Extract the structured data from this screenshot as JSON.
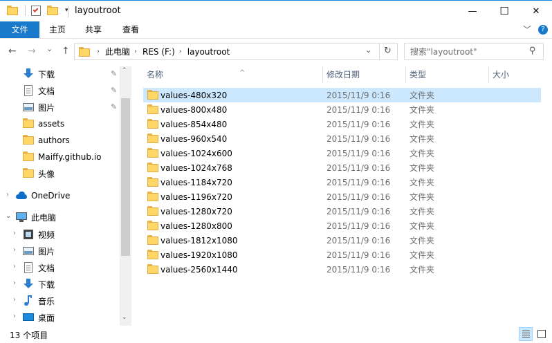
{
  "window": {
    "title": "layoutroot",
    "minimize_glyph": "—",
    "maximize_glyph": "☐",
    "close_glyph": "✕"
  },
  "ribbon": {
    "tabs": [
      "文件",
      "主页",
      "共享",
      "查看"
    ],
    "expand_glyph": "﹀",
    "help_glyph": "?"
  },
  "address": {
    "back_glyph": "←",
    "forward_glyph": "→",
    "recent_glyph": "⌄",
    "up_glyph": "↑",
    "crumbs": [
      "此电脑",
      "RES (F:)",
      "layoutroot"
    ],
    "crumb_sep": "›",
    "dropdown_glyph": "⌄",
    "refresh_glyph": "↻",
    "search_placeholder": "搜索\"layoutroot\"",
    "search_glyph": "⚲"
  },
  "nav": {
    "pin_glyph": "✎",
    "chevron_glyph": "›",
    "open_chevron_glyph": "⌄",
    "scroll_up_glyph": "⌃",
    "scroll_down_glyph": "⌄",
    "quick_access": [
      {
        "label": "下载",
        "icon": "download-icon",
        "pinned": true
      },
      {
        "label": "文档",
        "icon": "document-icon",
        "pinned": true
      },
      {
        "label": "图片",
        "icon": "pictures-icon",
        "pinned": true
      },
      {
        "label": "assets",
        "icon": "folder-icon",
        "pinned": false
      },
      {
        "label": "authors",
        "icon": "folder-icon",
        "pinned": false
      },
      {
        "label": "Maiffy.github.io",
        "icon": "folder-icon",
        "pinned": false
      },
      {
        "label": "头像",
        "icon": "folder-icon",
        "pinned": false
      }
    ],
    "onedrive": "OneDrive",
    "this_pc": "此电脑",
    "pc_items": [
      {
        "label": "视频",
        "icon": "videos-icon"
      },
      {
        "label": "图片",
        "icon": "pictures-icon"
      },
      {
        "label": "文档",
        "icon": "document-icon"
      },
      {
        "label": "下载",
        "icon": "download-icon"
      },
      {
        "label": "音乐",
        "icon": "music-icon"
      },
      {
        "label": "桌面",
        "icon": "desktop-icon"
      }
    ]
  },
  "content": {
    "columns": [
      "名称",
      "修改日期",
      "类型",
      "大小"
    ],
    "sort_glyph": "^",
    "rows": [
      {
        "name": "values-480x320",
        "date": "2015/11/9 0:16",
        "type": "文件夹",
        "selected": true
      },
      {
        "name": "values-800x480",
        "date": "2015/11/9 0:16",
        "type": "文件夹",
        "selected": false
      },
      {
        "name": "values-854x480",
        "date": "2015/11/9 0:16",
        "type": "文件夹",
        "selected": false
      },
      {
        "name": "values-960x540",
        "date": "2015/11/9 0:16",
        "type": "文件夹",
        "selected": false
      },
      {
        "name": "values-1024x600",
        "date": "2015/11/9 0:16",
        "type": "文件夹",
        "selected": false
      },
      {
        "name": "values-1024x768",
        "date": "2015/11/9 0:16",
        "type": "文件夹",
        "selected": false
      },
      {
        "name": "values-1184x720",
        "date": "2015/11/9 0:16",
        "type": "文件夹",
        "selected": false
      },
      {
        "name": "values-1196x720",
        "date": "2015/11/9 0:16",
        "type": "文件夹",
        "selected": false
      },
      {
        "name": "values-1280x720",
        "date": "2015/11/9 0:16",
        "type": "文件夹",
        "selected": false
      },
      {
        "name": "values-1280x800",
        "date": "2015/11/9 0:16",
        "type": "文件夹",
        "selected": false
      },
      {
        "name": "values-1812x1080",
        "date": "2015/11/9 0:16",
        "type": "文件夹",
        "selected": false
      },
      {
        "name": "values-1920x1080",
        "date": "2015/11/9 0:16",
        "type": "文件夹",
        "selected": false
      },
      {
        "name": "values-2560x1440",
        "date": "2015/11/9 0:16",
        "type": "文件夹",
        "selected": false
      }
    ]
  },
  "status": {
    "count_text": "13 个项目"
  },
  "colors": {
    "accent": "#1979ca",
    "selection": "#cce8ff",
    "folder": "#ffd766"
  }
}
